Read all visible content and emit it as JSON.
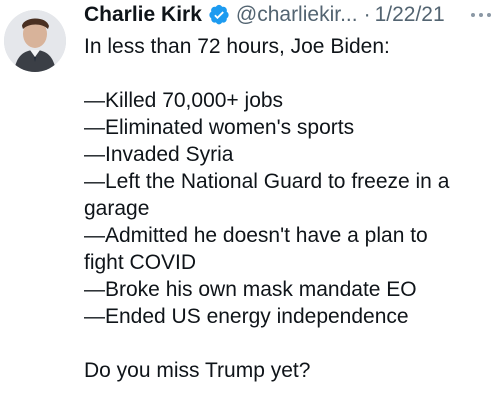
{
  "user": {
    "name": "Charlie Kirk",
    "handle": "@charliekir...",
    "separator": "·",
    "date": "1/22/21"
  },
  "tweet": {
    "intro": "In less than 72 hours, Joe Biden:",
    "items": [
      "—Killed 70,000+ jobs",
      "—Eliminated women's sports",
      "—Invaded Syria",
      "—Left the National Guard to freeze in a",
      "garage",
      "—Admitted he doesn't have a plan to",
      "fight COVID",
      "—Broke his own mask mandate EO",
      "—Ended US energy independence"
    ],
    "closing": "Do you miss Trump yet?"
  },
  "colors": {
    "verified": "#1d9bf0",
    "muted": "#536471",
    "text": "#0f1419"
  },
  "icons": {
    "verified": "verified-badge-icon",
    "more": "more-options-icon"
  }
}
